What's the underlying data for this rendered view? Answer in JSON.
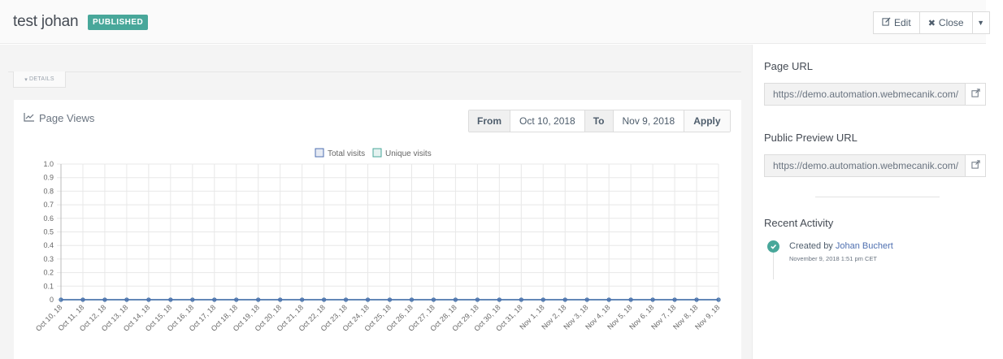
{
  "header": {
    "title": "test johan",
    "status": "PUBLISHED",
    "edit_label": "Edit",
    "close_label": "Close"
  },
  "details": {
    "toggle_label": "DETAILS"
  },
  "page_views": {
    "title": "Page Views",
    "from_label": "From",
    "from_value": "Oct 10, 2018",
    "to_label": "To",
    "to_value": "Nov 9, 2018",
    "apply_label": "Apply"
  },
  "sidebar": {
    "page_url_title": "Page URL",
    "page_url_value": "https://demo.automation.webmecanik.com/",
    "preview_url_title": "Public Preview URL",
    "preview_url_value": "https://demo.automation.webmecanik.com/",
    "recent_activity_title": "Recent Activity",
    "activity": {
      "prefix": "Created by",
      "user": "Johan Buchert",
      "time": "November 9, 2018 1:51 pm CET"
    }
  },
  "colors": {
    "accent": "#48a79a",
    "total_visits": "#4e6fb0",
    "unique_visits": "#48a79a"
  },
  "chart_data": {
    "type": "line",
    "ylim": [
      0,
      1.0
    ],
    "yticks": [
      "0",
      "0.1",
      "0.2",
      "0.3",
      "0.4",
      "0.5",
      "0.6",
      "0.7",
      "0.8",
      "0.9",
      "1.0"
    ],
    "grid": true,
    "legend_position": "top",
    "categories": [
      "Oct 10, 18",
      "Oct 11, 18",
      "Oct 12, 18",
      "Oct 13, 18",
      "Oct 14, 18",
      "Oct 15, 18",
      "Oct 16, 18",
      "Oct 17, 18",
      "Oct 18, 18",
      "Oct 19, 18",
      "Oct 20, 18",
      "Oct 21, 18",
      "Oct 22, 18",
      "Oct 23, 18",
      "Oct 24, 18",
      "Oct 25, 18",
      "Oct 26, 18",
      "Oct 27, 18",
      "Oct 28, 18",
      "Oct 29, 18",
      "Oct 30, 18",
      "Oct 31, 18",
      "Nov 1, 18",
      "Nov 2, 18",
      "Nov 3, 18",
      "Nov 4, 18",
      "Nov 5, 18",
      "Nov 6, 18",
      "Nov 7, 18",
      "Nov 8, 18",
      "Nov 9, 18"
    ],
    "series": [
      {
        "name": "Total visits",
        "color": "#4e6fb0",
        "values": [
          0,
          0,
          0,
          0,
          0,
          0,
          0,
          0,
          0,
          0,
          0,
          0,
          0,
          0,
          0,
          0,
          0,
          0,
          0,
          0,
          0,
          0,
          0,
          0,
          0,
          0,
          0,
          0,
          0,
          0,
          0
        ]
      },
      {
        "name": "Unique visits",
        "color": "#48a79a",
        "values": [
          0,
          0,
          0,
          0,
          0,
          0,
          0,
          0,
          0,
          0,
          0,
          0,
          0,
          0,
          0,
          0,
          0,
          0,
          0,
          0,
          0,
          0,
          0,
          0,
          0,
          0,
          0,
          0,
          0,
          0,
          0
        ]
      }
    ]
  }
}
